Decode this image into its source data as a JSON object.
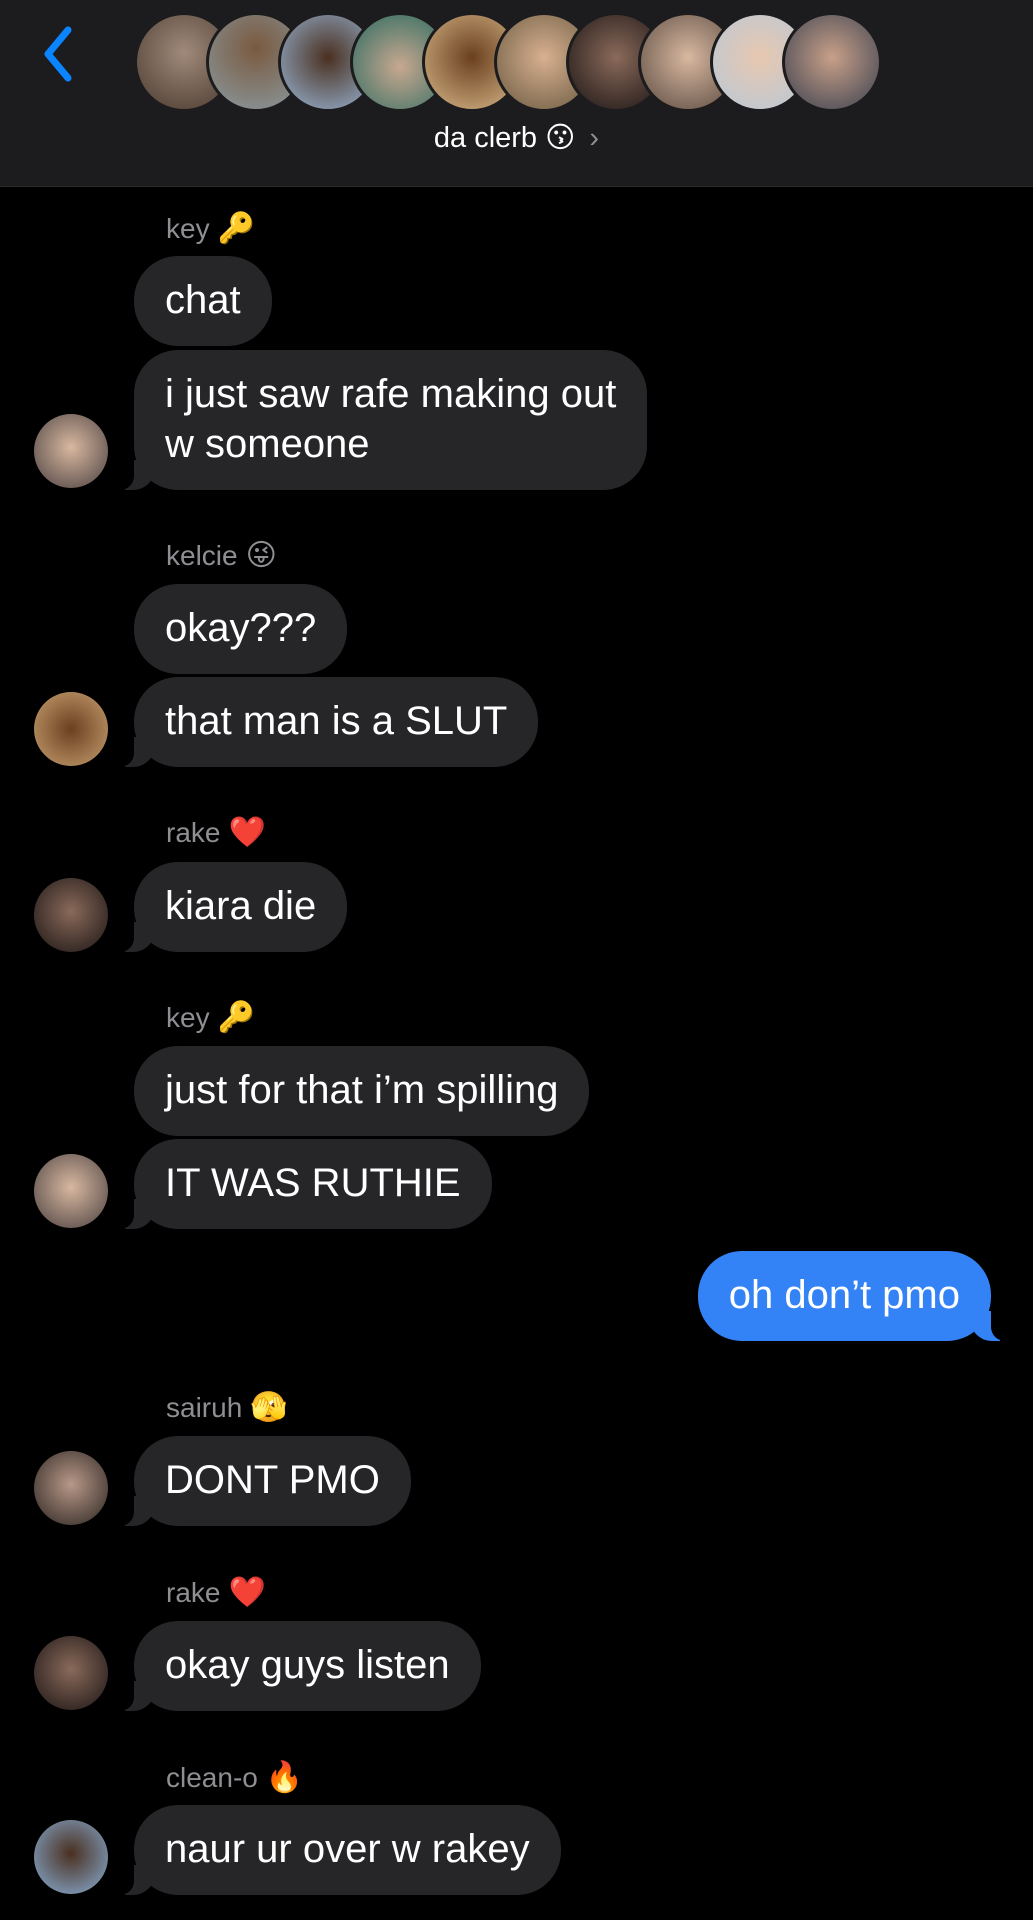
{
  "header": {
    "group_name": "da clerb",
    "group_emoji": "😗",
    "chevron": "›",
    "avatar_colors": [
      "#6b5a4f",
      "#8a7a6a",
      "#7aa0c8",
      "#3c8c7c",
      "#c9a070",
      "#b88a6a",
      "#3a3030",
      "#a88a70",
      "#d8c8b8",
      "#5a6a80"
    ]
  },
  "messages": [
    {
      "sender": "key",
      "emoji": "🔑",
      "lines": [
        "chat",
        "i just saw rafe making out\nw someone"
      ]
    },
    {
      "sender": "kelcie",
      "emoji": "😜",
      "lines": [
        "okay???",
        "that man is a SLUT"
      ]
    },
    {
      "sender": "rake",
      "emoji": "❤️",
      "lines": [
        "kiara die"
      ]
    },
    {
      "sender": "key",
      "emoji": "🔑",
      "lines": [
        "just for that i’m spilling",
        "IT WAS RUTHIE"
      ]
    },
    {
      "mine": "oh don’t pmo"
    },
    {
      "sender": "sairuh",
      "emoji": "🫣",
      "lines": [
        "DONT PMO"
      ]
    },
    {
      "sender": "rake",
      "emoji": "❤️",
      "lines": [
        "okay guys listen"
      ]
    },
    {
      "sender": "clean-o",
      "emoji": "🔥",
      "lines": [
        "naur ur over w rakey"
      ]
    }
  ],
  "colors": {
    "bubble_other": "#262629",
    "bubble_mine": "#3483f6",
    "accent": "#0a84ff"
  }
}
